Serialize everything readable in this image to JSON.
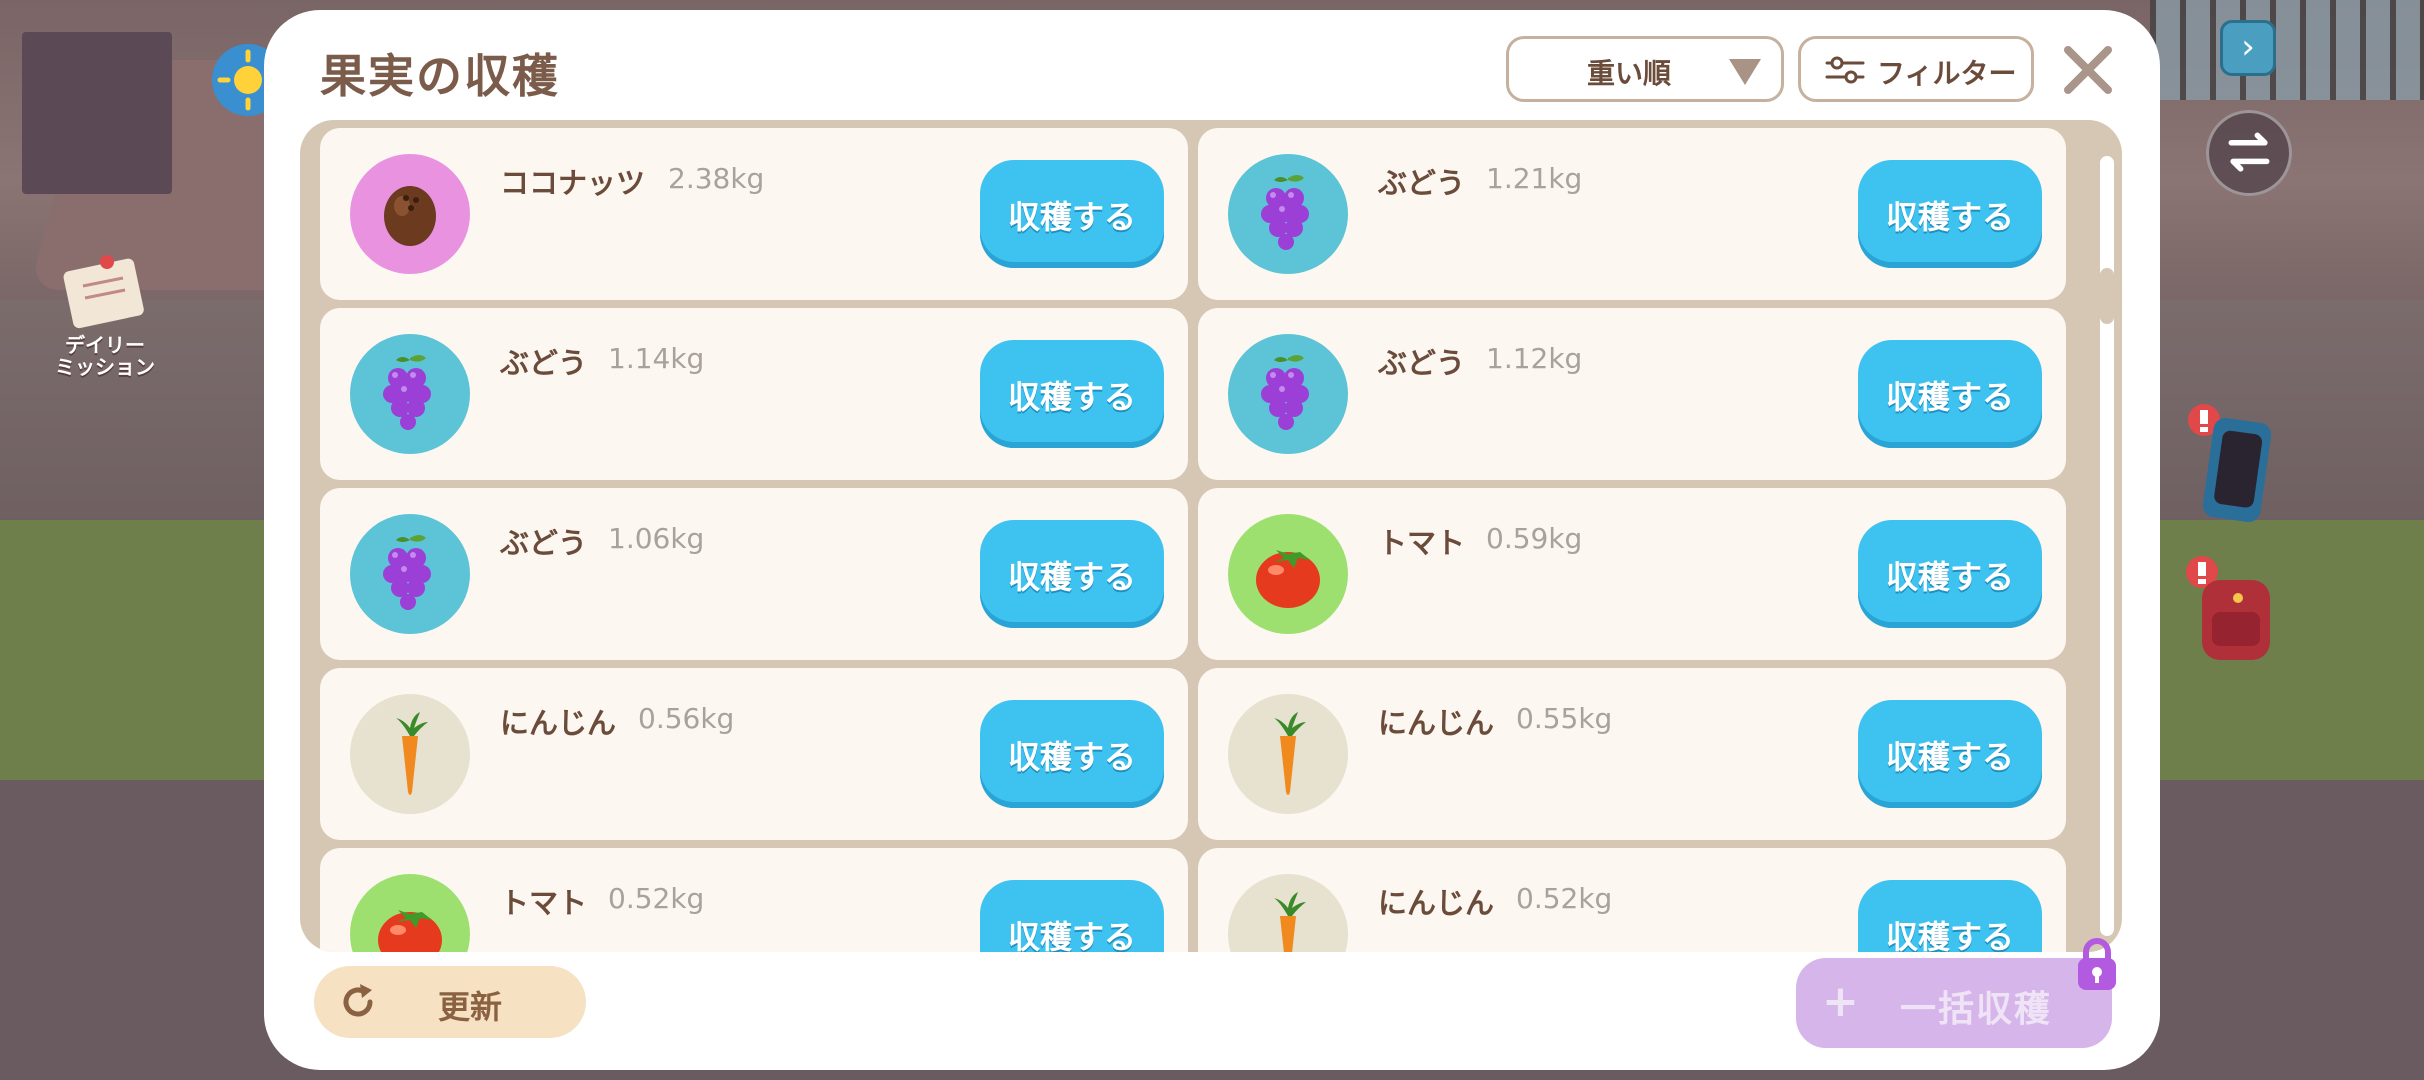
{
  "hud": {
    "daily_mission_label": "デイリー\nミッション"
  },
  "dialog": {
    "title": "果実の収穫",
    "sort": {
      "selected": "重い順"
    },
    "filter_label": "フィルター",
    "refresh_label": "更新",
    "bulk_harvest_label": "一括収穫",
    "bulk_harvest_locked": true
  },
  "items": [
    {
      "name": "ココナッツ",
      "weight": "2.38kg",
      "icon": "coconut-icon",
      "bg": "#e993e0",
      "button": "収穫する"
    },
    {
      "name": "ぶどう",
      "weight": "1.21kg",
      "icon": "grape-icon",
      "bg": "#5cc4d6",
      "button": "収穫する"
    },
    {
      "name": "ぶどう",
      "weight": "1.14kg",
      "icon": "grape-icon",
      "bg": "#5cc4d6",
      "button": "収穫する"
    },
    {
      "name": "ぶどう",
      "weight": "1.12kg",
      "icon": "grape-icon",
      "bg": "#5cc4d6",
      "button": "収穫する"
    },
    {
      "name": "ぶどう",
      "weight": "1.06kg",
      "icon": "grape-icon",
      "bg": "#5cc4d6",
      "button": "収穫する"
    },
    {
      "name": "トマト",
      "weight": "0.59kg",
      "icon": "tomato-icon",
      "bg": "#9ee070",
      "button": "収穫する"
    },
    {
      "name": "にんじん",
      "weight": "0.56kg",
      "icon": "carrot-icon",
      "bg": "#e6e2cf",
      "button": "収穫する"
    },
    {
      "name": "にんじん",
      "weight": "0.55kg",
      "icon": "carrot-icon",
      "bg": "#e6e2cf",
      "button": "収穫する"
    },
    {
      "name": "トマト",
      "weight": "0.52kg",
      "icon": "tomato-icon",
      "bg": "#9ee070",
      "button": "収穫する"
    },
    {
      "name": "にんじん",
      "weight": "0.52kg",
      "icon": "carrot-icon",
      "bg": "#e6e2cf",
      "button": "収穫する"
    }
  ],
  "colors": {
    "accent_blue": "#3ec3f1",
    "title_brown": "#7b5c4b",
    "frame_tan": "#d6c7b4",
    "bulk_purple": "#d6b5ea"
  }
}
